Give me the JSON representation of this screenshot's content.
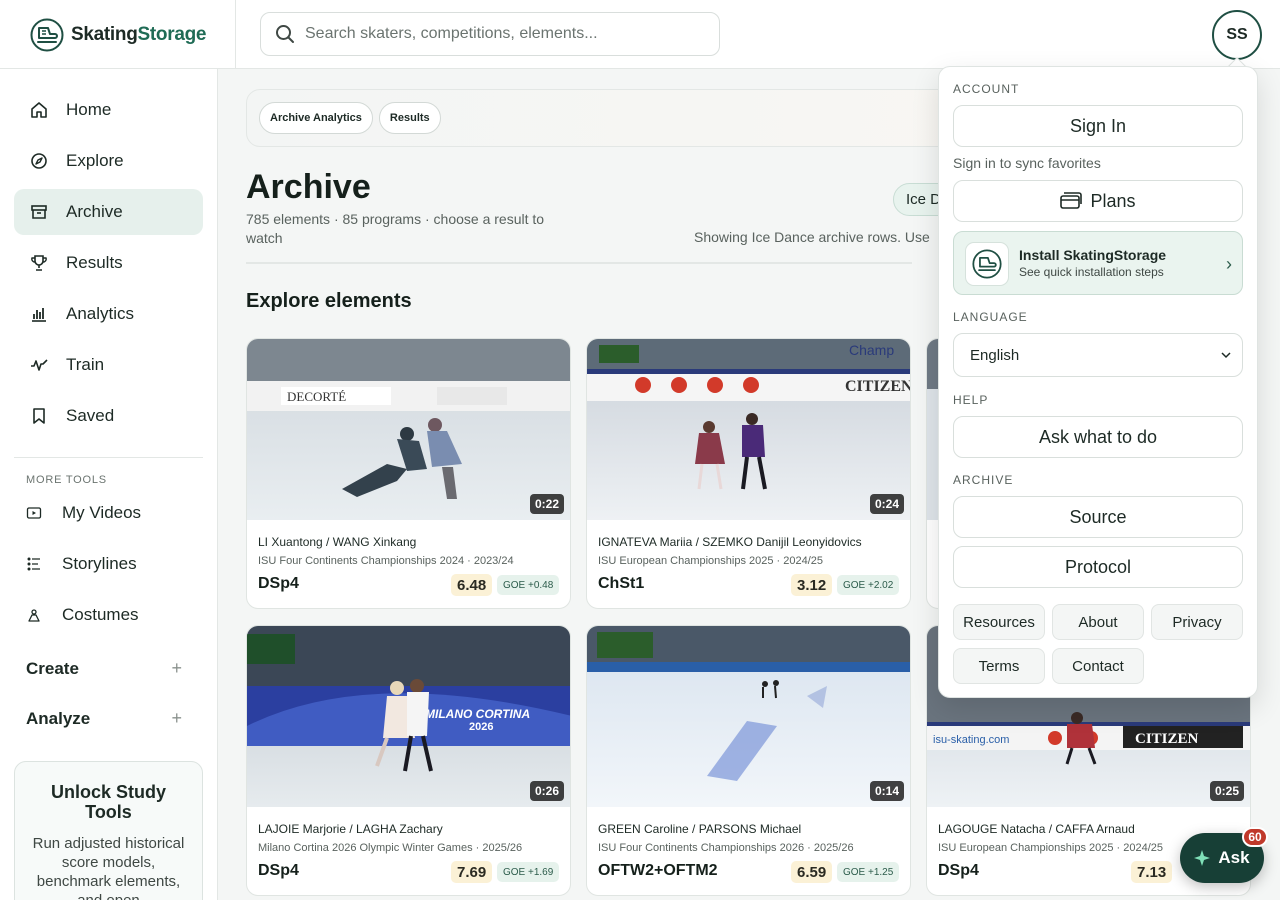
{
  "brand": {
    "name_part1": "Skating",
    "name_part2": "Storage"
  },
  "search": {
    "placeholder": "Search skaters, competitions, elements..."
  },
  "user": {
    "initials": "SS"
  },
  "sidebar": {
    "items": [
      {
        "label": "Home",
        "icon": "home-icon"
      },
      {
        "label": "Explore",
        "icon": "compass-icon"
      },
      {
        "label": "Archive",
        "icon": "archive-icon",
        "active": true
      },
      {
        "label": "Results",
        "icon": "trophy-icon"
      },
      {
        "label": "Analytics",
        "icon": "bar-chart-icon"
      },
      {
        "label": "Train",
        "icon": "activity-icon"
      },
      {
        "label": "Saved",
        "icon": "bookmark-icon"
      }
    ],
    "more_tools_label": "MORE TOOLS",
    "tools": [
      {
        "label": "My Videos",
        "icon": "video-icon"
      },
      {
        "label": "Storylines",
        "icon": "storyline-icon"
      },
      {
        "label": "Costumes",
        "icon": "costume-icon"
      }
    ],
    "create_label": "Create",
    "analyze_label": "Analyze",
    "unlock": {
      "title": "Unlock Study Tools",
      "body": "Run adjusted historical score models, benchmark elements, and open"
    }
  },
  "breadcrumbs": [
    "Archive Analytics",
    "Results"
  ],
  "page": {
    "title": "Archive",
    "subtitle": "785 elements · 85 programs · choose a result to watch",
    "filter_pill": "Ice D",
    "showing_text": "Showing Ice Dance archive rows. Use",
    "section_title": "Explore elements"
  },
  "cards": [
    {
      "names": "LI Xuantong / WANG Xinkang",
      "competition": "ISU Four Continents Championships 2024 · 2023/24",
      "element": "DSp4",
      "score": "6.48",
      "goe": "GOE +0.48",
      "duration": "0:22"
    },
    {
      "names": "IGNATEVA Mariia / SZEMKO Danijil Leonyidovics",
      "competition": "ISU European Championships 2025 · 2024/25",
      "element": "ChSt1",
      "score": "3.12",
      "goe": "GOE +2.02",
      "duration": "0:24"
    },
    {
      "names": "LAJOIE Marjorie / LAGHA Zachary",
      "competition": "Milano Cortina 2026 Olympic Winter Games · 2025/26",
      "element": "DSp4",
      "score": "7.69",
      "goe": "GOE +1.69",
      "duration": "0:26"
    },
    {
      "names": "GREEN Caroline / PARSONS Michael",
      "competition": "ISU Four Continents Championships 2026 · 2025/26",
      "element": "OFTW2+OFTM2",
      "score": "6.59",
      "goe": "GOE +1.25",
      "duration": "0:14"
    },
    {
      "names": "LAGOUGE Natacha / CAFFA Arnaud",
      "competition": "ISU European Championships 2025 · 2024/25",
      "element": "DSp4",
      "score": "7.13",
      "goe": "",
      "duration": "0:25"
    }
  ],
  "thumb_texts": {
    "decorte": "DECORTÉ",
    "citizen": "CITIZEN",
    "milano": "MILANO CORTINA",
    "milano_year": "2026",
    "champ": "Champ",
    "isu_site": "isu-skating.com"
  },
  "menu": {
    "account_label": "ACCOUNT",
    "sign_in": "Sign In",
    "sign_in_note": "Sign in to sync favorites",
    "plans": "Plans",
    "install_title": "Install SkatingStorage",
    "install_sub": "See quick installation steps",
    "language_label": "LANGUAGE",
    "language_value": "English",
    "help_label": "HELP",
    "ask_what": "Ask what to do",
    "archive_label": "ARCHIVE",
    "source": "Source",
    "protocol": "Protocol",
    "links": [
      "Resources",
      "About",
      "Privacy",
      "Terms",
      "Contact"
    ]
  },
  "ask": {
    "label": "Ask",
    "badge": "60"
  }
}
